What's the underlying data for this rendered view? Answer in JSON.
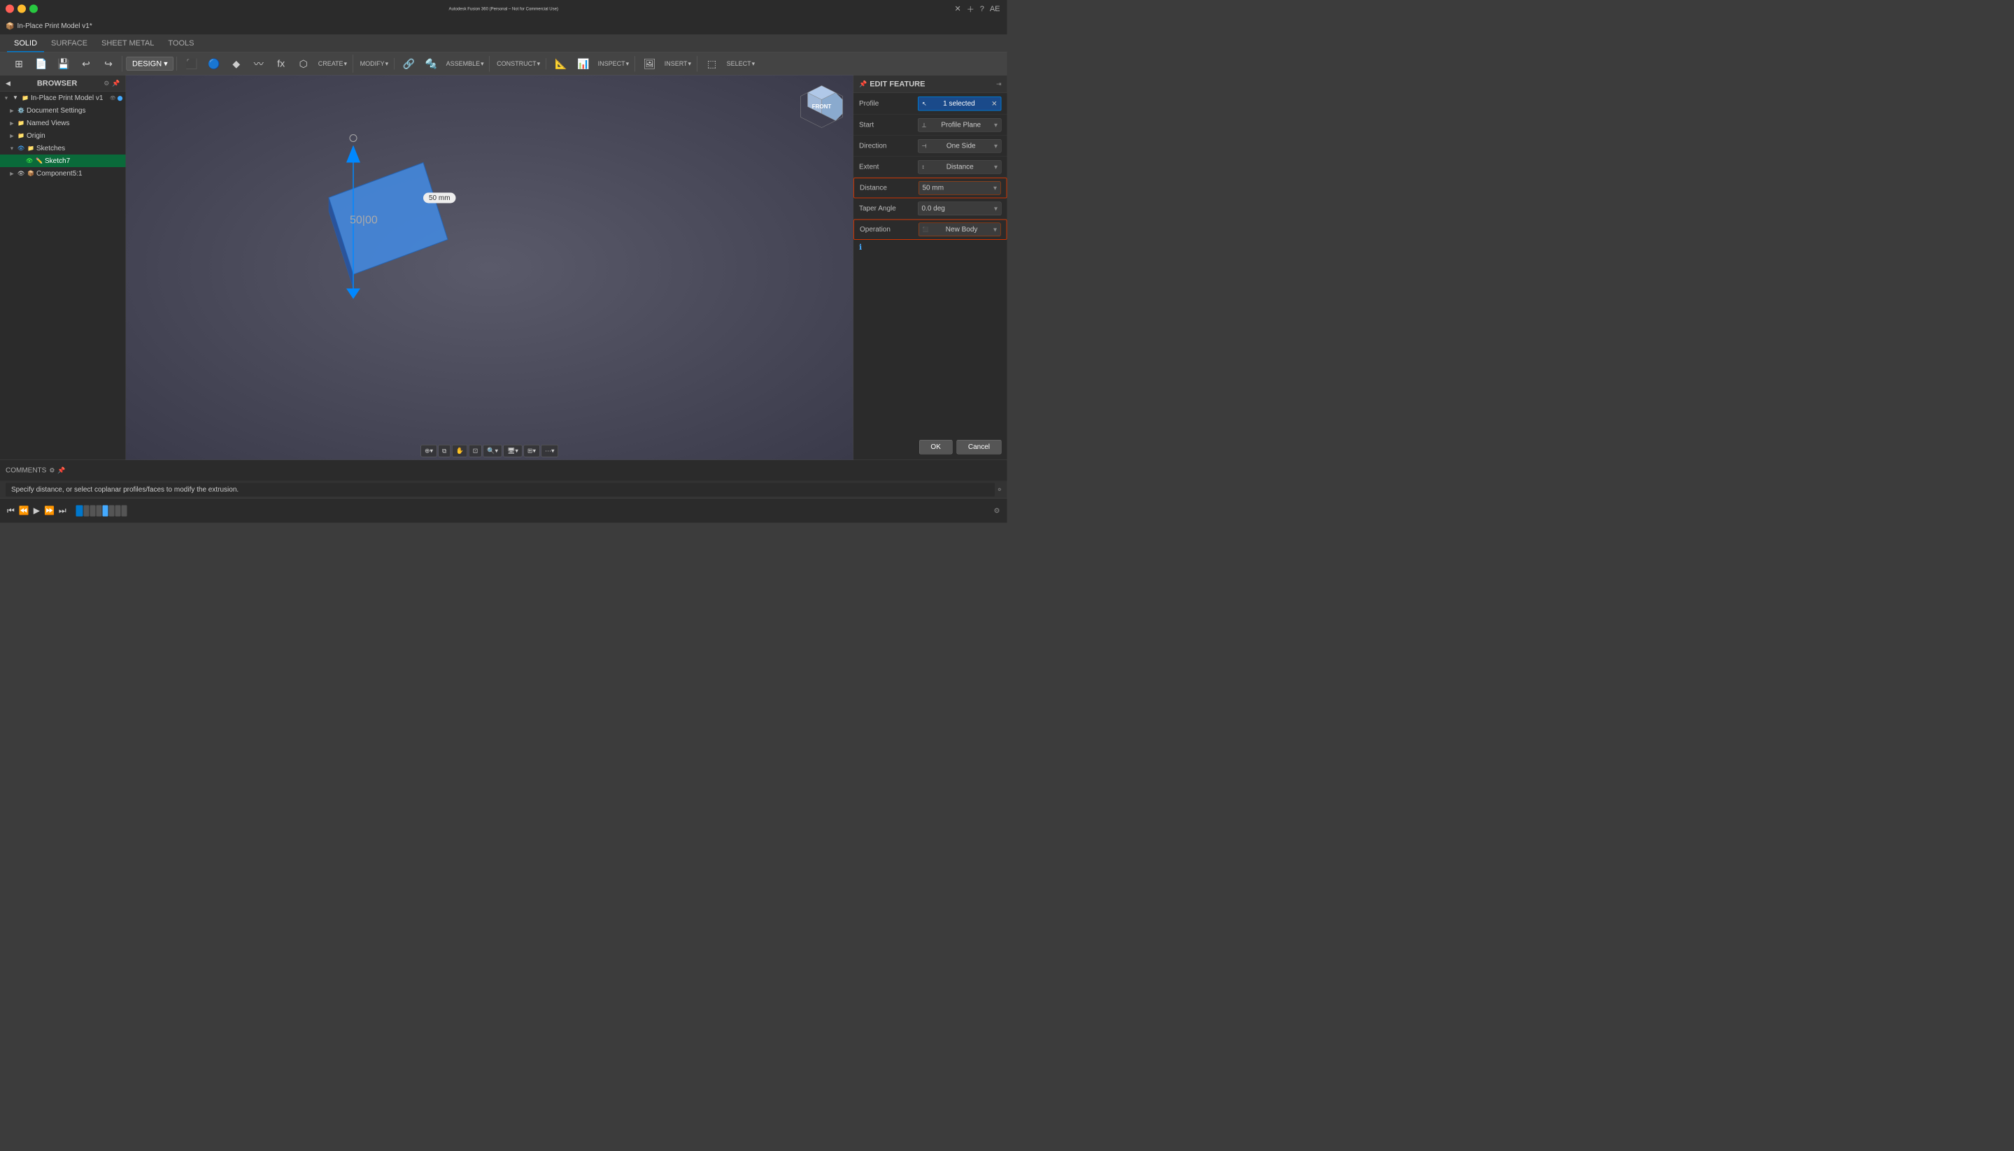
{
  "titlebar": {
    "title": "Autodesk Fusion 360 (Personal – Not for Commercial Use)",
    "model_name": "In-Place Print Model v1*"
  },
  "tabs": [
    {
      "id": "solid",
      "label": "SOLID",
      "active": true
    },
    {
      "id": "surface",
      "label": "SURFACE",
      "active": false
    },
    {
      "id": "sheet_metal",
      "label": "SHEET METAL",
      "active": false
    },
    {
      "id": "tools",
      "label": "TOOLS",
      "active": false
    }
  ],
  "toolbar_groups": [
    {
      "id": "design",
      "label": "DESIGN ▾"
    },
    {
      "id": "create",
      "items": [
        {
          "id": "create-box",
          "label": "CREATE ▾"
        }
      ]
    },
    {
      "id": "modify",
      "items": [
        {
          "id": "modify",
          "label": "MODIFY ▾"
        }
      ]
    },
    {
      "id": "assemble",
      "items": [
        {
          "id": "assemble",
          "label": "ASSEMBLE ▾"
        }
      ]
    },
    {
      "id": "construct",
      "items": [
        {
          "id": "construct",
          "label": "CONSTRUCT ▾"
        }
      ]
    },
    {
      "id": "inspect",
      "items": [
        {
          "id": "inspect",
          "label": "INSPECT ▾"
        }
      ]
    },
    {
      "id": "insert",
      "items": [
        {
          "id": "insert",
          "label": "INSERT ▾"
        }
      ]
    },
    {
      "id": "select",
      "items": [
        {
          "id": "select",
          "label": "SELECT ▾"
        }
      ]
    }
  ],
  "browser": {
    "title": "BROWSER",
    "tree": [
      {
        "id": "root",
        "label": "In-Place Print Model v1",
        "indent": 0,
        "expanded": true,
        "has_eye": true,
        "icon": "📁"
      },
      {
        "id": "doc-settings",
        "label": "Document Settings",
        "indent": 1,
        "expanded": false,
        "icon": "⚙️"
      },
      {
        "id": "named-views",
        "label": "Named Views",
        "indent": 1,
        "expanded": false,
        "icon": "📁"
      },
      {
        "id": "origin",
        "label": "Origin",
        "indent": 1,
        "expanded": false,
        "icon": "📁"
      },
      {
        "id": "sketches",
        "label": "Sketches",
        "indent": 1,
        "expanded": true,
        "has_eye": true,
        "icon": "📁"
      },
      {
        "id": "sketch7",
        "label": "Sketch7",
        "indent": 2,
        "selected": true,
        "has_eye": true,
        "icon": "✏️"
      },
      {
        "id": "component",
        "label": "Component5:1",
        "indent": 1,
        "expanded": false,
        "has_eye": true,
        "icon": "📦"
      }
    ]
  },
  "edit_panel": {
    "title": "EDIT FEATURE",
    "rows": [
      {
        "id": "profile",
        "label": "Profile",
        "value": "1 selected",
        "type": "selected",
        "has_clear": true
      },
      {
        "id": "start",
        "label": "Start",
        "value": "Profile Plane",
        "type": "dropdown"
      },
      {
        "id": "direction",
        "label": "Direction",
        "value": "One Side",
        "type": "dropdown"
      },
      {
        "id": "extent",
        "label": "Extent",
        "value": "Distance",
        "type": "dropdown"
      },
      {
        "id": "distance",
        "label": "Distance",
        "value": "50 mm",
        "type": "dropdown",
        "highlighted": true
      },
      {
        "id": "taper-angle",
        "label": "Taper Angle",
        "value": "0.0 deg",
        "type": "dropdown"
      },
      {
        "id": "operation",
        "label": "Operation",
        "value": "New Body",
        "type": "dropdown",
        "highlighted": true
      }
    ],
    "ok_label": "OK",
    "cancel_label": "Cancel"
  },
  "dimension": {
    "label": "50 mm",
    "value": "50|00"
  },
  "status": {
    "text": "Specify distance, or select coplanar profiles/faces to modify the extrusion.",
    "comments_label": "COMMENTS"
  },
  "view_cube": {
    "label": "FRONT"
  },
  "viewport_tools": [
    {
      "id": "snap",
      "label": "⊕"
    },
    {
      "id": "copy",
      "label": "⧉"
    },
    {
      "id": "pan",
      "label": "✋"
    },
    {
      "id": "zoom-fit",
      "label": "⊡"
    },
    {
      "id": "zoom",
      "label": "🔍"
    },
    {
      "id": "display",
      "label": "🖥"
    },
    {
      "id": "grid",
      "label": "⊞"
    },
    {
      "id": "more",
      "label": "⋯"
    }
  ]
}
